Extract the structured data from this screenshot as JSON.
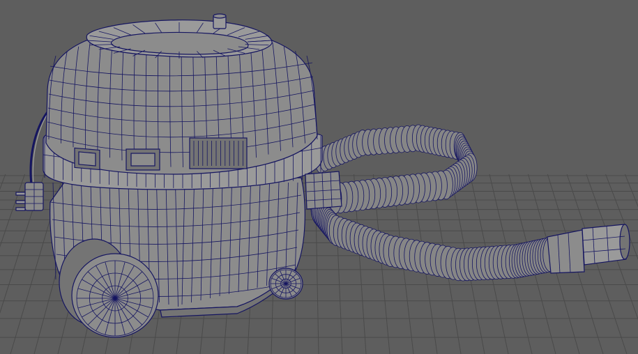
{
  "viewport": {
    "background_color": "#5e5e5e",
    "grid_color": "#4a4a4a",
    "wire_color": "#151560",
    "shade_color": "#8c8c8c"
  },
  "model": {
    "subject": "vacuum-cleaner-wireframe"
  }
}
